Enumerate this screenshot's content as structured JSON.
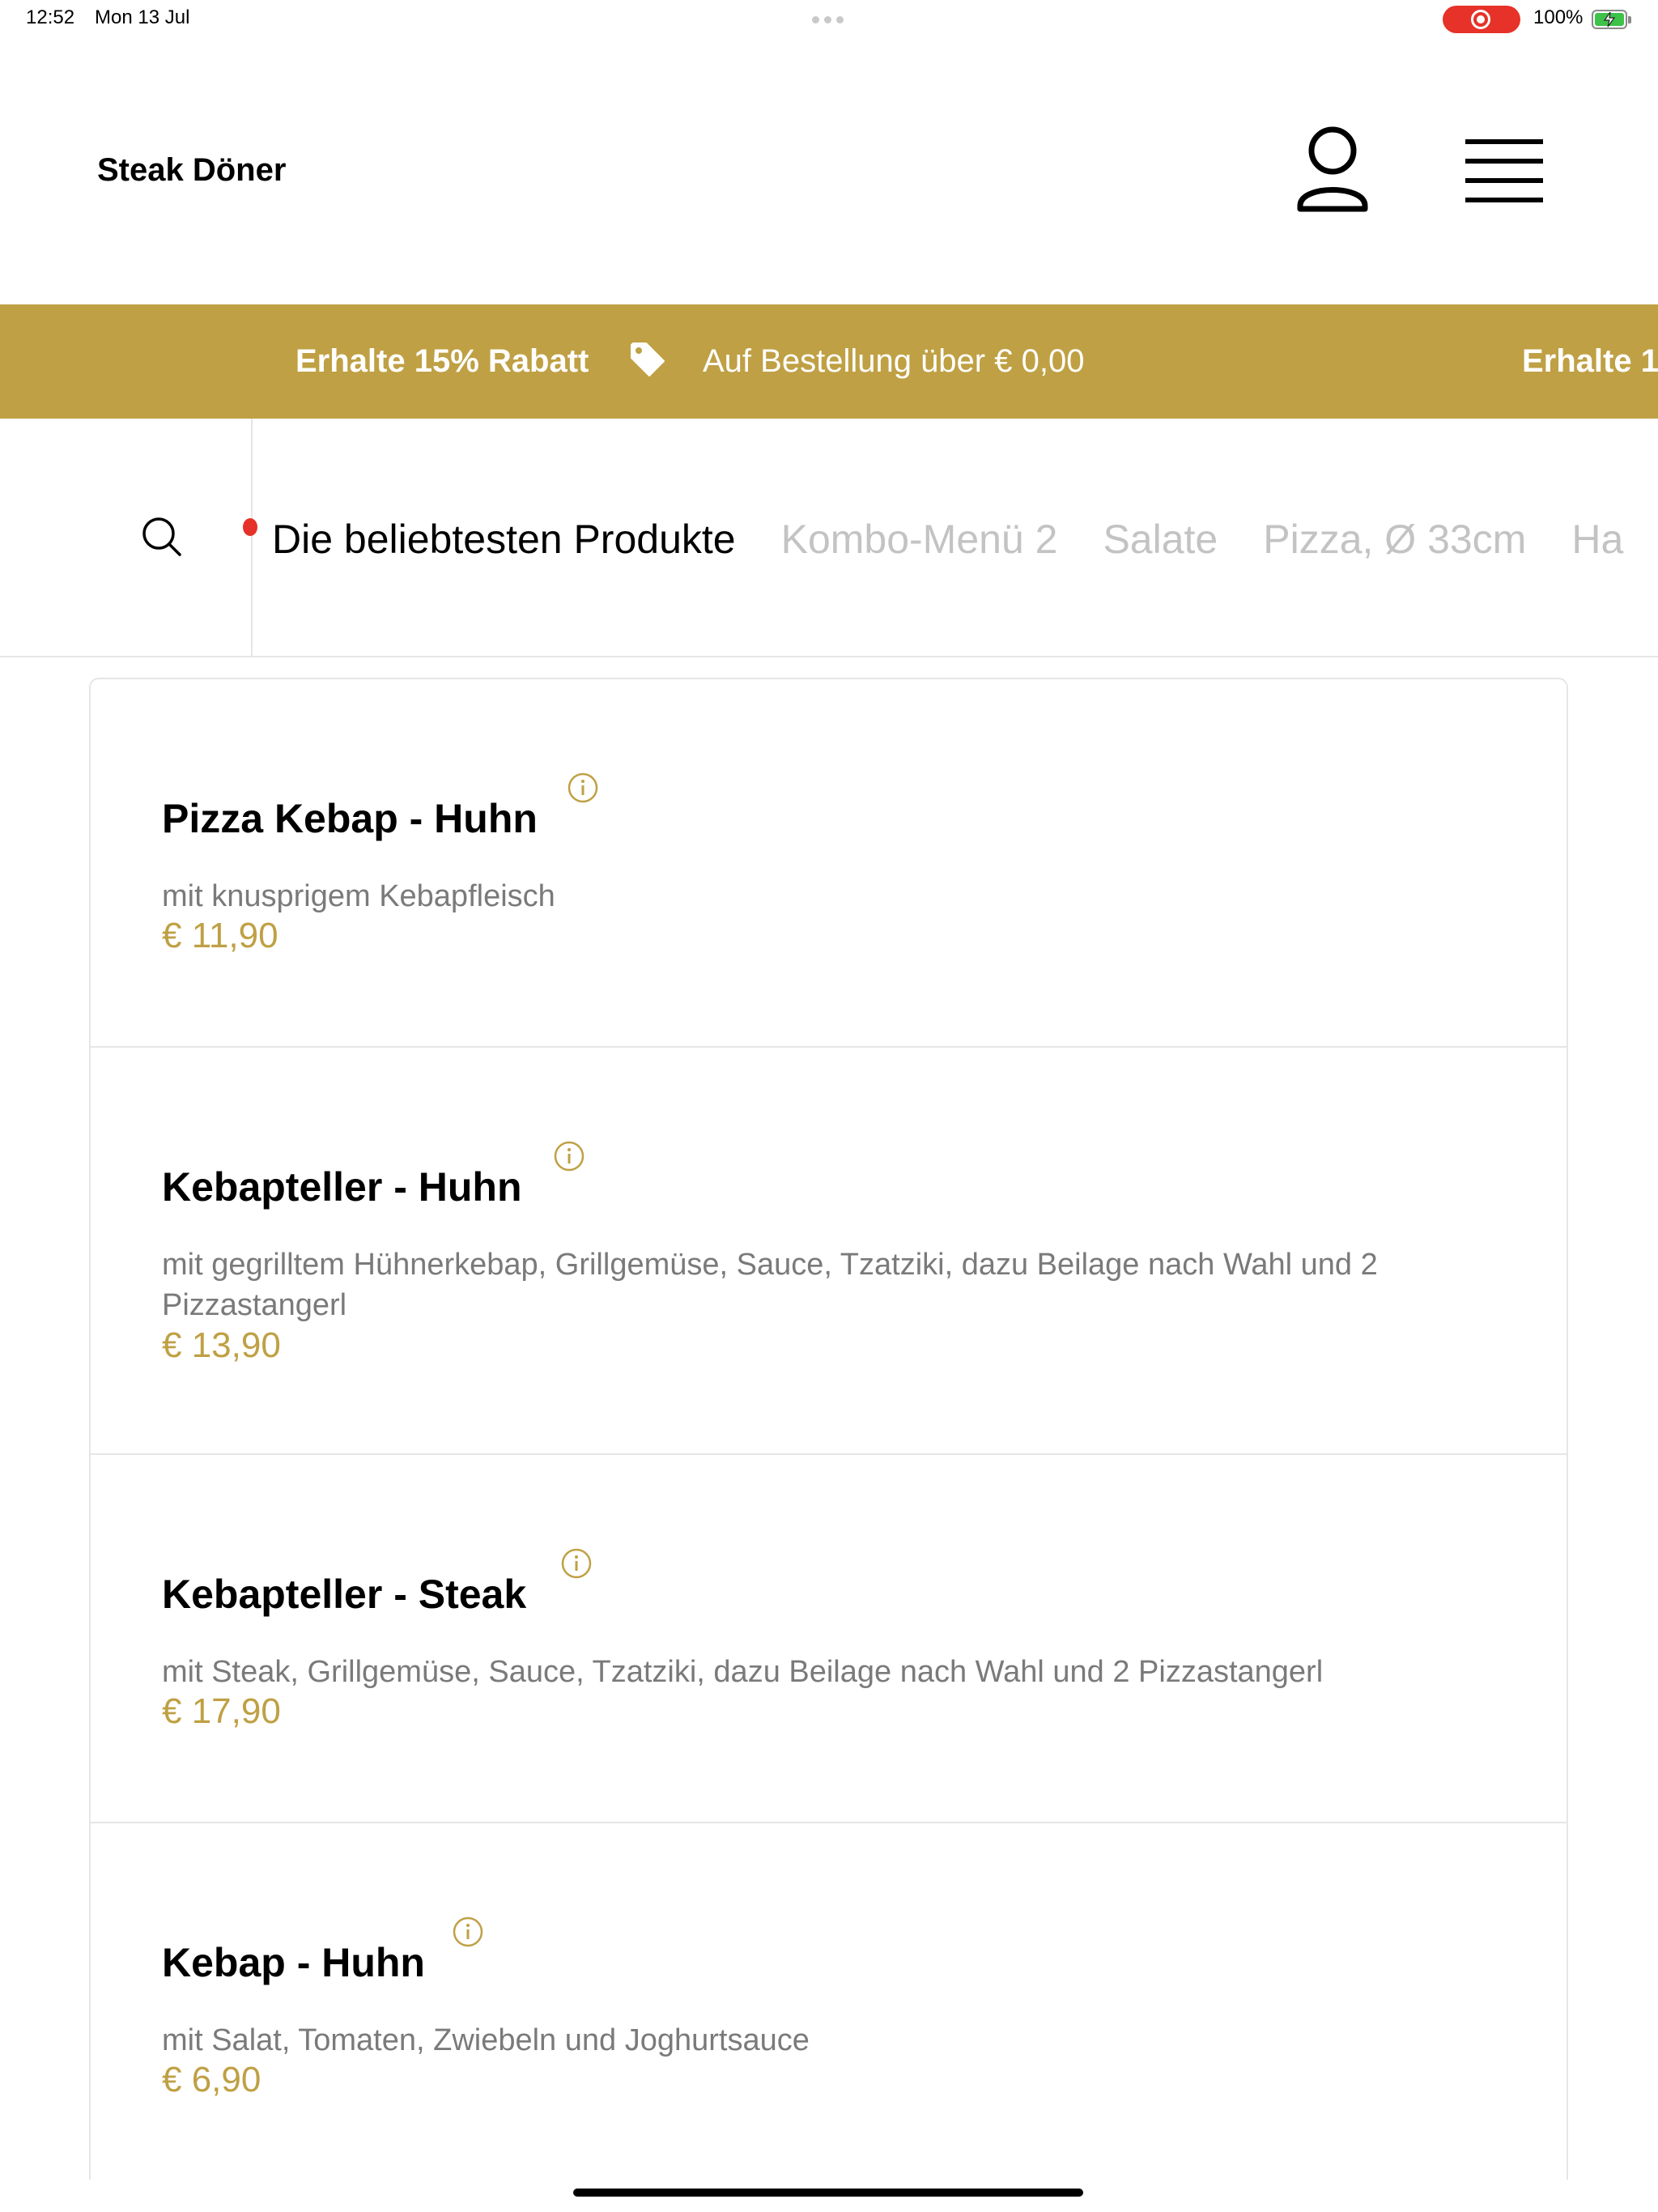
{
  "status_bar": {
    "time": "12:52",
    "date": "Mon 13 Jul",
    "battery": "100%"
  },
  "header": {
    "brand": "Steak Döner",
    "icons": {
      "user": "user-icon",
      "menu": "menu-icon"
    }
  },
  "promo": {
    "title": "Erhalte 15% Rabatt",
    "subtitle": "Auf Bestellung über € 0,00",
    "title_repeat": "Erhalte 1",
    "background": "#bfa044"
  },
  "categories": {
    "active_index": 0,
    "items": [
      "Die beliebtesten Produkte",
      "Kombo-Menü 2",
      "Salate",
      "Pizza, Ø 33cm",
      "Ha"
    ]
  },
  "products": [
    {
      "name": "Pizza Kebap - Huhn",
      "description": "mit knusprigem Kebapfleisch",
      "price": "€ 11,90"
    },
    {
      "name": "Kebapteller - Huhn",
      "description": "mit gegrilltem Hühnerkebap, Grillgemüse, Sauce, Tzatziki, dazu Beilage nach Wahl und 2 Pizzastangerl",
      "price": "€ 13,90"
    },
    {
      "name": "Kebapteller - Steak",
      "description": "mit Steak, Grillgemüse, Sauce, Tzatziki, dazu Beilage nach Wahl und 2 Pizzastangerl",
      "price": "€ 17,90"
    },
    {
      "name": "Kebap - Huhn",
      "description": "mit Salat, Tomaten, Zwiebeln und Joghurtsauce",
      "price": "€ 6,90"
    }
  ],
  "colors": {
    "accent": "#bfa044",
    "text": "#000000",
    "muted": "#7a7a7a",
    "inactive_tab": "#c3c3c3",
    "record": "#e63228"
  }
}
